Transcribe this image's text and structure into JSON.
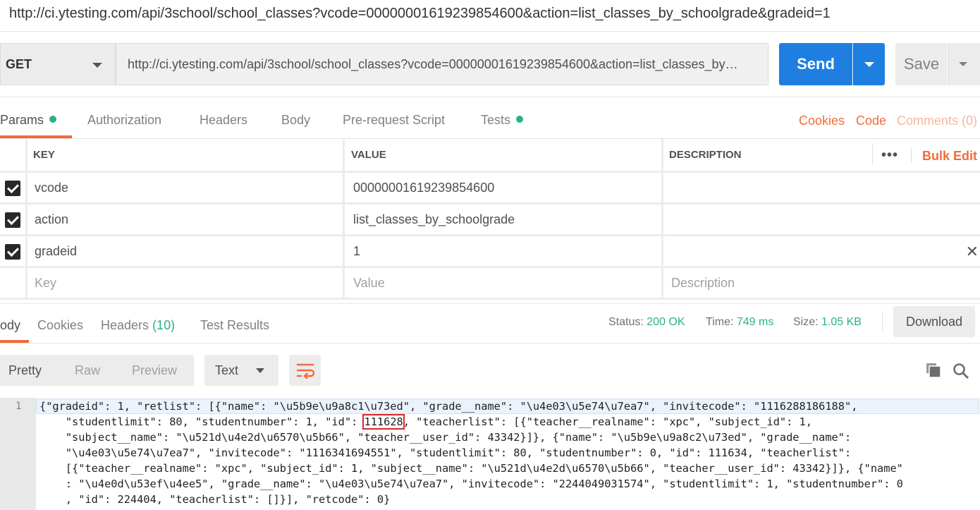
{
  "window": {
    "title": "http://ci.ytesting.com/api/3school/school_classes?vcode=00000001619239854600&action=list_classes_by_schoolgrade&gradeid=1"
  },
  "request": {
    "method": "GET",
    "url": "http://ci.ytesting.com/api/3school/school_classes?vcode=00000001619239854600&action=list_classes_by…",
    "send_label": "Send",
    "save_label": "Save"
  },
  "request_tabs": [
    {
      "label": "Params",
      "dot": true
    },
    {
      "label": "Authorization",
      "dot": false
    },
    {
      "label": "Headers",
      "dot": false
    },
    {
      "label": "Body",
      "dot": false
    },
    {
      "label": "Pre-request Script",
      "dot": false
    },
    {
      "label": "Tests",
      "dot": true
    }
  ],
  "right_links": {
    "cookies": "Cookies",
    "code": "Code",
    "comments": "Comments (0)"
  },
  "params": {
    "headers": {
      "key": "KEY",
      "value": "VALUE",
      "description": "DESCRIPTION"
    },
    "more": "•••",
    "bulk_edit": "Bulk Edit",
    "rows": [
      {
        "key": "vcode",
        "value": "00000001619239854600",
        "description": ""
      },
      {
        "key": "action",
        "value": "list_classes_by_schoolgrade",
        "description": ""
      },
      {
        "key": "gradeid",
        "value": "1",
        "description": ""
      }
    ],
    "placeholders": {
      "key": "Key",
      "value": "Value",
      "description": "Description"
    },
    "delete_glyph": "✕"
  },
  "response_tabs": {
    "body": "ody",
    "cookies": "Cookies",
    "headers": "Headers",
    "headers_count": "(10)",
    "test_results": "Test Results"
  },
  "response_status": {
    "status_label": "Status:",
    "status_value": "200 OK",
    "time_label": "Time:",
    "time_value": "749 ms",
    "size_label": "Size:",
    "size_value": "1.05 KB",
    "download": "Download"
  },
  "view": {
    "pretty": "Pretty",
    "raw": "Raw",
    "preview": "Preview",
    "format": "Text"
  },
  "code": {
    "line_number": "1",
    "lines": [
      {
        "pre": "{\"gradeid\": 1, \"retlist\": [{\"name\": \"\\u5b9e\\u9a8c1\\u73ed\", \"grade__name\": \"\\u4e03\\u5e74\\u7ea7\", \"invitecode\": \"1116288186188\",",
        "hl": "",
        "post": ""
      },
      {
        "pre": "    \"studentlimit\": 80, \"studentnumber\": 1, \"id\": ",
        "hl": "111628",
        "post": ", \"teacherlist\": [{\"teacher__realname\": \"xpc\", \"subject_id\": 1,"
      },
      {
        "pre": "    \"subject__name\": \"\\u521d\\u4e2d\\u6570\\u5b66\", \"teacher__user_id\": 43342}]}, {\"name\": \"\\u5b9e\\u9a8c2\\u73ed\", \"grade__name\":",
        "hl": "",
        "post": ""
      },
      {
        "pre": "    \"\\u4e03\\u5e74\\u7ea7\", \"invitecode\": \"1116341694551\", \"studentlimit\": 80, \"studentnumber\": 0, \"id\": 111634, \"teacherlist\":",
        "hl": "",
        "post": ""
      },
      {
        "pre": "    [{\"teacher__realname\": \"xpc\", \"subject_id\": 1, \"subject__name\": \"\\u521d\\u4e2d\\u6570\\u5b66\", \"teacher__user_id\": 43342}]}, {\"name\"",
        "hl": "",
        "post": ""
      },
      {
        "pre": "    : \"\\u4e0d\\u53ef\\u4ee5\", \"grade__name\": \"\\u4e03\\u5e74\\u7ea7\", \"invitecode\": \"2244049031574\", \"studentlimit\": 1, \"studentnumber\": 0",
        "hl": "",
        "post": ""
      },
      {
        "pre": "    , \"id\": 224404, \"teacherlist\": []}], \"retcode\": 0}",
        "hl": "",
        "post": ""
      }
    ]
  },
  "colors": {
    "accent_orange": "#f26b3a",
    "send_blue": "#1f7fe0",
    "status_green": "#26b47f",
    "highlight_red": "#d9262a"
  },
  "icons": {
    "method_caret": "chevron-down-icon",
    "send_caret": "chevron-down-icon",
    "save_caret": "chevron-down-icon",
    "wrap": "wrap-lines-icon",
    "copy": "copy-icon",
    "search": "search-icon",
    "checkbox": "checkbox-checked-icon",
    "delete": "close-icon"
  }
}
